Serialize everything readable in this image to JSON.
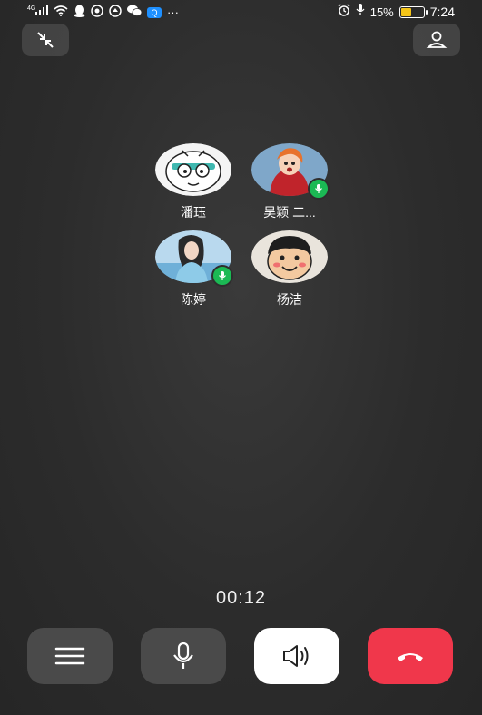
{
  "status_bar": {
    "network_label": "4G",
    "battery_text": "15%",
    "battery_level": 0.15,
    "time": "7:24",
    "left_icons": [
      "signal-icon",
      "wifi-icon",
      "qq-penguin-icon",
      "notification-icon",
      "notification-icon",
      "wechat-icon",
      "qq-icon",
      "more-dots-icon"
    ],
    "right_icons": [
      "alarm-icon",
      "mic-icon",
      "battery-icon"
    ],
    "more_glyph": "···"
  },
  "top_controls": {
    "minimize_icon": "minimize-arrows-icon",
    "contact_icon": "person-icon"
  },
  "participants": [
    {
      "name": "潘珏",
      "speaking": false,
      "avatar": "cartoon-cat-avatar"
    },
    {
      "name": "吴颖 二...",
      "speaking": true,
      "avatar": "anime-character-avatar"
    },
    {
      "name": "陈婷",
      "speaking": true,
      "avatar": "girl-photo-avatar"
    },
    {
      "name": "杨洁",
      "speaking": false,
      "avatar": "cartoon-face-avatar"
    }
  ],
  "call": {
    "duration": "00:12"
  },
  "controls": [
    {
      "id": "menu",
      "icon": "menu-icon"
    },
    {
      "id": "mute",
      "icon": "microphone-icon"
    },
    {
      "id": "speaker",
      "icon": "speaker-icon",
      "active": true
    },
    {
      "id": "hangup",
      "icon": "hang-up-phone-icon"
    }
  ],
  "colors": {
    "speaking_badge": "#1bb954",
    "hangup": "#f0374b",
    "button_bg": "#4a4a4a",
    "speaker_active": "#ffffff"
  }
}
